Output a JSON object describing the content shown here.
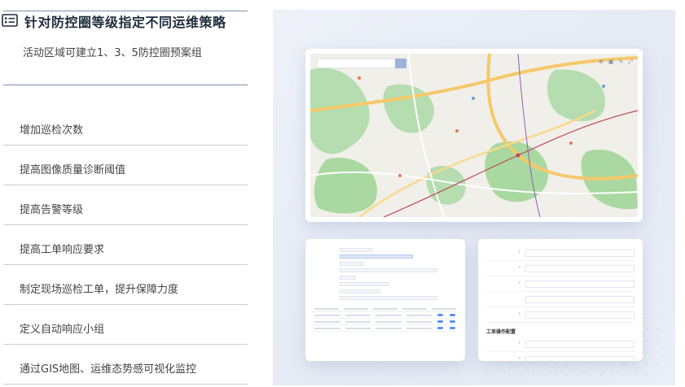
{
  "header": {
    "icon": "list-checklist-icon",
    "title": "针对防控圈等级指定不同运维策略",
    "subtitle": "活动区域可建立1、3、5防控圈预案组"
  },
  "strategies": [
    {
      "label": "增加巡检次数"
    },
    {
      "label": "提高图像质量诊断阈值"
    },
    {
      "label": "提高告警等级"
    },
    {
      "label": "提高工单响应要求"
    },
    {
      "label": "制定现场巡检工单，提升保障力度"
    },
    {
      "label": "定义自动响应小组"
    },
    {
      "label": "通过GIS地图、运维态势感可视化监控"
    }
  ],
  "colors": {
    "accent": "#5b8ff0",
    "panel_bg": "#e8ecf5",
    "map_green": "#a9d9a0",
    "map_road": "#f6c86a"
  },
  "form_right": {
    "section_label": "工单操作配置"
  }
}
